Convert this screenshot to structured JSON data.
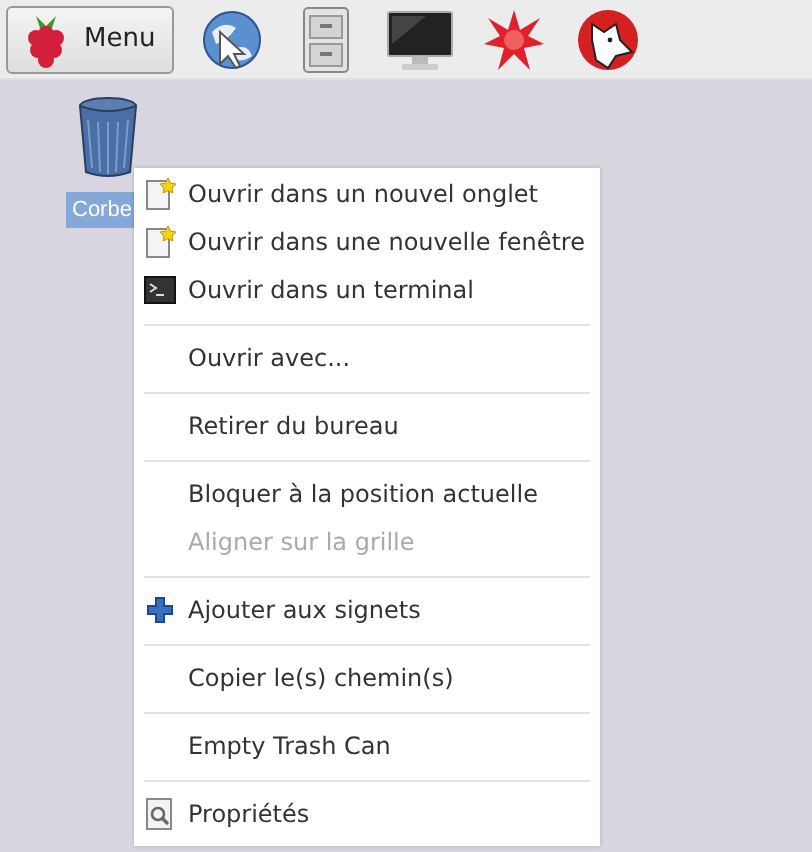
{
  "taskbar": {
    "menu_button": "Menu"
  },
  "desktop_icon": {
    "label": "Corbe",
    "selected": true
  },
  "context_menu": [
    {
      "kind": "item",
      "label": "Ouvrir dans un nouvel onglet",
      "disabled": false
    },
    {
      "kind": "item",
      "label": "Ouvrir dans une nouvelle fenêtre",
      "disabled": false
    },
    {
      "kind": "item",
      "label": "Ouvrir dans un terminal",
      "disabled": false
    },
    {
      "kind": "separator"
    },
    {
      "kind": "item",
      "label": "Ouvrir avec...",
      "disabled": false
    },
    {
      "kind": "separator"
    },
    {
      "kind": "item",
      "label": "Retirer du bureau",
      "disabled": false
    },
    {
      "kind": "separator"
    },
    {
      "kind": "item",
      "label": "Bloquer à la position actuelle",
      "disabled": false
    },
    {
      "kind": "item",
      "label": "Aligner sur la grille",
      "disabled": true
    },
    {
      "kind": "separator"
    },
    {
      "kind": "item",
      "label": "Ajouter aux signets",
      "disabled": false
    },
    {
      "kind": "separator"
    },
    {
      "kind": "item",
      "label": "Copier le(s) chemin(s)",
      "disabled": false
    },
    {
      "kind": "separator"
    },
    {
      "kind": "item",
      "label": "Empty Trash Can",
      "disabled": false
    },
    {
      "kind": "separator"
    },
    {
      "kind": "item",
      "label": "Propriétés",
      "disabled": false
    }
  ]
}
